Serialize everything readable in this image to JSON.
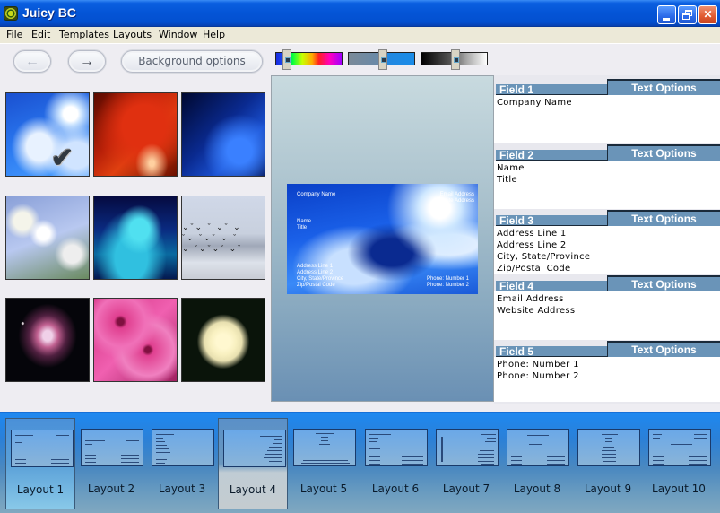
{
  "window": {
    "title": "Juicy BC",
    "controls": {
      "minimize": "minimize",
      "maximize": "restore",
      "close": "close"
    }
  },
  "menu": [
    "File",
    "Edit",
    "Templates",
    "Layouts",
    "Window",
    "Help"
  ],
  "toolbar": {
    "back_icon": "arrow-left-icon",
    "forward_icon": "arrow-right-icon",
    "back_glyph": "←",
    "forward_glyph": "→",
    "background_options_label": "Background options",
    "sliders": [
      {
        "name": "hue",
        "value": 0.1
      },
      {
        "name": "saturation",
        "value": 0.5
      },
      {
        "name": "brightness",
        "value": 0.5
      }
    ]
  },
  "backgrounds": {
    "selected_index": 0,
    "items": [
      "sky-clouds",
      "red-texture",
      "blue-texture",
      "white-blossoms",
      "cyan-clouds",
      "birds-over-water",
      "nebula",
      "pink-flowers",
      "white-rose"
    ]
  },
  "preview": {
    "card": {
      "company": "Company Name",
      "name": "Name",
      "title": "Title",
      "email": "Email Address",
      "website": "Website Address",
      "address1": "Address Line 1",
      "address2": "Address Line 2",
      "city": "City, State/Province",
      "zip": "Zip/Postal Code",
      "phone1": "Phone: Number 1",
      "phone2": "Phone: Number 2"
    }
  },
  "fields": [
    {
      "label": "Field 1",
      "options": "Text Options",
      "lines": [
        "Company Name"
      ]
    },
    {
      "label": "Field 2",
      "options": "Text Options",
      "lines": [
        "Name",
        "Title"
      ]
    },
    {
      "label": "Field 3",
      "options": "Text Options",
      "lines": [
        "Address Line 1",
        "Address Line 2",
        "City, State/Province",
        "Zip/Postal Code"
      ]
    },
    {
      "label": "Field 4",
      "options": "Text Options",
      "lines": [
        "Email Address",
        "Website Address"
      ]
    },
    {
      "label": "Field 5",
      "options": "Text Options",
      "lines": [
        "Phone: Number 1",
        "Phone: Number 2"
      ]
    }
  ],
  "layouts": {
    "selected": "Layout 1",
    "hovered": "Layout 4",
    "items": [
      "Layout 1",
      "Layout 2",
      "Layout 3",
      "Layout 4",
      "Layout 5",
      "Layout 6",
      "Layout 7",
      "Layout 8",
      "Layout 9",
      "Layout 10"
    ]
  }
}
